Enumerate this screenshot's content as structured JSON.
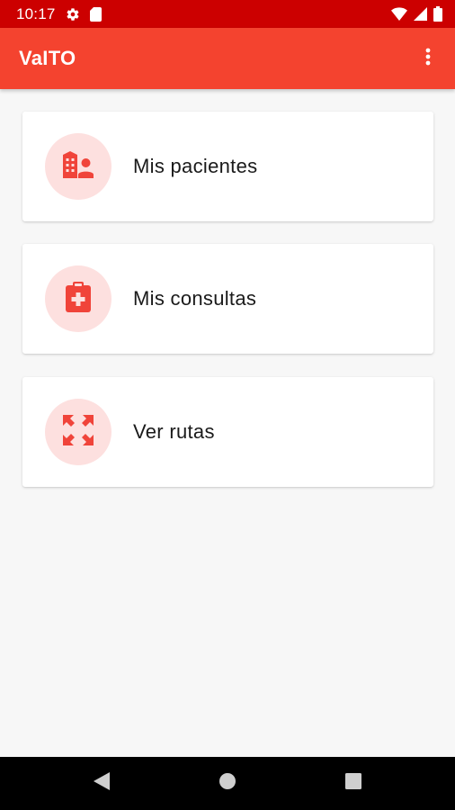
{
  "status_bar": {
    "time": "10:17",
    "icons": [
      "settings-icon",
      "sd-card-icon",
      "wifi-icon",
      "signal-icon",
      "battery-icon"
    ]
  },
  "app_bar": {
    "title": "VaITO",
    "menu_icon": "more-vert-icon"
  },
  "menu_items": [
    {
      "label": "Mis pacientes",
      "icon": "hospital-patient-icon"
    },
    {
      "label": "Mis consultas",
      "icon": "clipboard-medical-icon"
    },
    {
      "label": "Ver rutas",
      "icon": "expand-arrows-icon"
    }
  ],
  "nav_bar": {
    "buttons": [
      "back-icon",
      "home-icon",
      "recents-icon"
    ]
  },
  "colors": {
    "status_bar": "#cc0000",
    "app_bar": "#f4432f",
    "accent_icon": "#f0443a",
    "icon_circle": "#fde0df",
    "background": "#f7f7f7"
  }
}
